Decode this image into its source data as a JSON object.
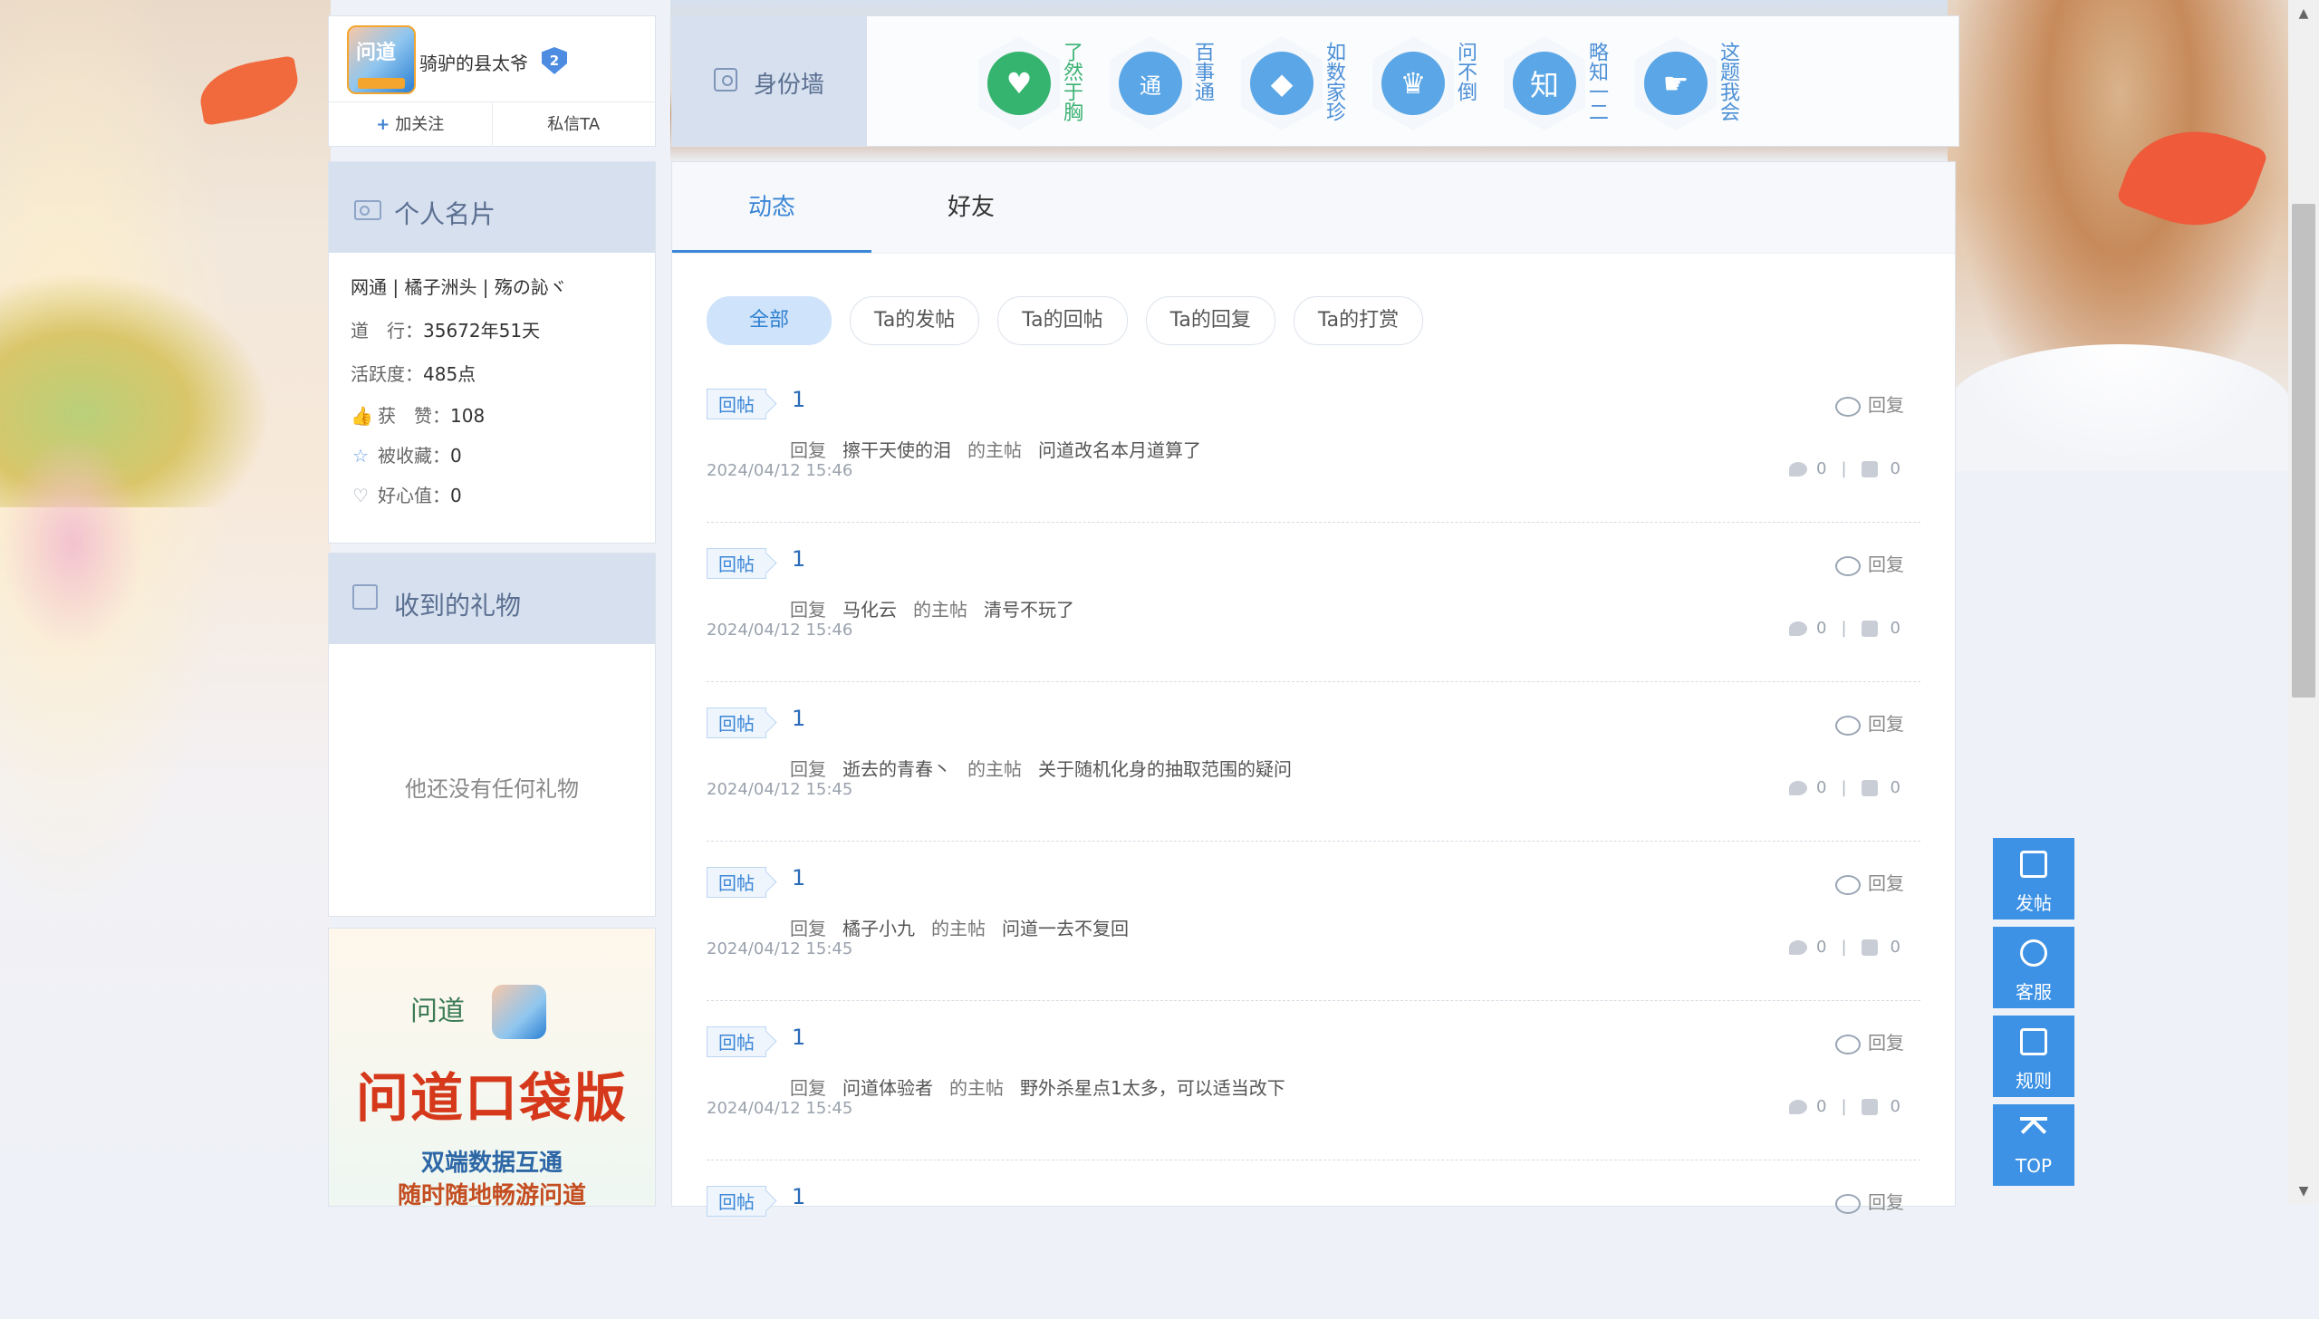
{
  "profile": {
    "username": "骑驴的县太爷",
    "level": "2",
    "avatar_text": "问道",
    "follow_label": "加关注",
    "message_label": "私信TA"
  },
  "identity_wall": {
    "label": "身份墙",
    "badges": [
      {
        "name": "了然于胸",
        "icon": "heart-leaf-icon",
        "color": "#35b46f"
      },
      {
        "name": "百事通",
        "icon": "book-icon",
        "glyph": "通",
        "color": "#5aa6e6"
      },
      {
        "name": "如数家珍",
        "icon": "diamond-icon",
        "color": "#5aa6e6"
      },
      {
        "name": "问不倒",
        "icon": "trophy-icon",
        "color": "#5aa6e6"
      },
      {
        "name": "略知一二",
        "icon": "know-icon",
        "glyph": "知",
        "color": "#5aa6e6"
      },
      {
        "name": "这题我会",
        "icon": "hand-icon",
        "color": "#5aa6e6"
      }
    ]
  },
  "personal_card": {
    "title": "个人名片",
    "tags": "网通 | 橘子洲头 | 殇の訫ヾ",
    "daoxing_label": "道　行：",
    "daoxing_value": "35672年51天",
    "activity_label": "活跃度：",
    "activity_value": "485点",
    "likes_label": "获　赞：",
    "likes_value": "108",
    "favorited_label": "被收藏：",
    "favorited_value": "0",
    "goodwill_label": "好心值：",
    "goodwill_value": "0"
  },
  "gift_card": {
    "title": "收到的礼物",
    "empty_text": "他还没有任何礼物"
  },
  "promo": {
    "logo_text": "问道",
    "title": "问道口袋版",
    "line1": "双端数据互通",
    "line2": "随时随地畅游问道"
  },
  "main": {
    "tabs": [
      "动态",
      "好友"
    ],
    "filters": [
      "全部",
      "Ta的发帖",
      "Ta的回帖",
      "Ta的回复",
      "Ta的打赏"
    ],
    "reply_label": "回复",
    "items": [
      {
        "tag": "回帖",
        "title": "1",
        "action": "回复",
        "user": "擦干天使的泪",
        "of_thread": "的主帖",
        "thread": "问道改名本月道算了",
        "time": "2024/04/12 15:46",
        "comments": "0",
        "likes": "0"
      },
      {
        "tag": "回帖",
        "title": "1",
        "action": "回复",
        "user": "马化云",
        "of_thread": "的主帖",
        "thread": "清号不玩了",
        "time": "2024/04/12 15:46",
        "comments": "0",
        "likes": "0"
      },
      {
        "tag": "回帖",
        "title": "1",
        "action": "回复",
        "user": "逝去的青春丶",
        "of_thread": "的主帖",
        "thread": "关于随机化身的抽取范围的疑问",
        "time": "2024/04/12 15:45",
        "comments": "0",
        "likes": "0"
      },
      {
        "tag": "回帖",
        "title": "1",
        "action": "回复",
        "user": "橘子小九",
        "of_thread": "的主帖",
        "thread": "问道一去不复回",
        "time": "2024/04/12 15:45",
        "comments": "0",
        "likes": "0"
      },
      {
        "tag": "回帖",
        "title": "1",
        "action": "回复",
        "user": "问道体验者",
        "of_thread": "的主帖",
        "thread": "野外杀星点1太多，可以适当改下",
        "time": "2024/04/12 15:45",
        "comments": "0",
        "likes": "0"
      },
      {
        "tag": "回帖",
        "title": "1"
      }
    ]
  },
  "float_buttons": [
    "发帖",
    "客服",
    "规则",
    "TOP"
  ],
  "colors": {
    "accent": "#3b86d6",
    "float": "#3d92e5",
    "panel_header": "#d6e0ef"
  }
}
